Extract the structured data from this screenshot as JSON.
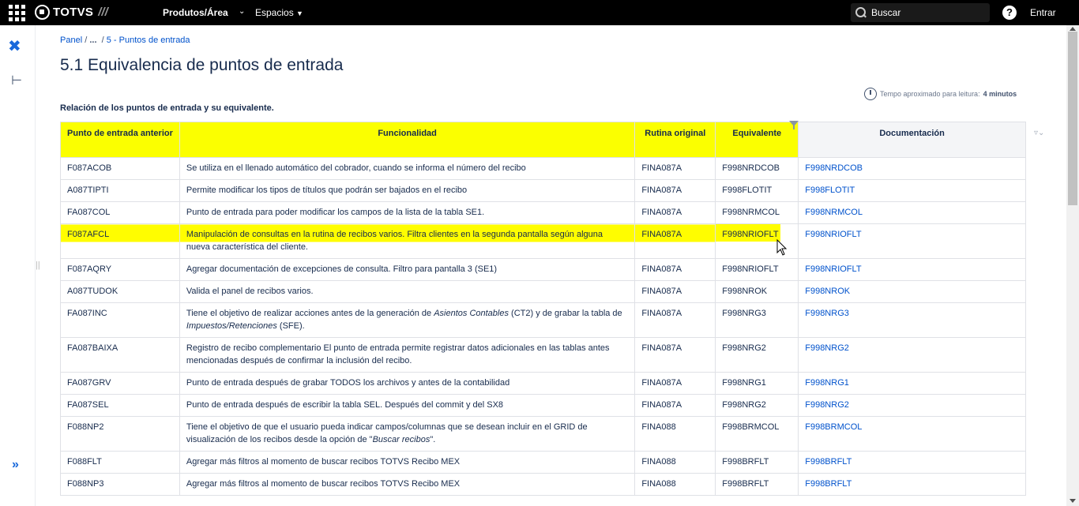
{
  "topbar": {
    "brand": "TOTVS",
    "brand_suffix": "///",
    "nav_productos": "Produtos/Área",
    "nav_espacios": "Espacios",
    "search_placeholder": "Buscar",
    "help": "?",
    "login": "Entrar"
  },
  "breadcrumb": {
    "panel": "Panel",
    "sep1": "/",
    "ellipsis": "...",
    "sep2": "/",
    "current": "5 - Puntos de entrada"
  },
  "page": {
    "title": "5.1 Equivalencia de puntos de entrada",
    "reading_prefix": "Tempo aproximado para leitura:",
    "reading_value": "4 minutos",
    "caption": "Relación de los puntos de entrada y su equivalente."
  },
  "table": {
    "headers": [
      "Punto de entrada anterior",
      "Funcionalidad",
      "Rutina original",
      "Equivalente",
      "Documentación"
    ],
    "rows": [
      {
        "pe": "F087ACOB",
        "func": "Se utiliza en el llenado automático del cobrador, cuando se informa el número del recibo",
        "rutina": "FINA087A",
        "equiv": "F998NRDCOB",
        "doc": "F998NRDCOB"
      },
      {
        "pe": "A087TIPTI",
        "func": "Permite modificar los tipos de títulos que podrán ser bajados en el recibo",
        "rutina": "FINA087A",
        "equiv": "F998FLOTIT",
        "doc": "F998FLOTIT"
      },
      {
        "pe": "FA087COL",
        "func": "Punto de entrada para poder modificar los campos de la lista de la tabla SE1.",
        "rutina": "FINA087A",
        "equiv": "F998NRMCOL",
        "doc": "F998NRMCOL"
      },
      {
        "pe": "F087AFCL",
        "func": "Manipulación de consultas en la rutina de recibos varios. Filtra clientes  en la segunda pantalla según alguna nueva característica del cliente.",
        "rutina": "FINA087A",
        "equiv": "F998NRIOFLT",
        "doc": "F998NRIOFLT"
      },
      {
        "pe": "F087AQRY",
        "func": "Agregar documentación de excepciones de consulta. Filtro para pantalla 3 (SE1)",
        "rutina": "FINA087A",
        "equiv": "F998NRIOFLT",
        "doc": "F998NRIOFLT"
      },
      {
        "pe": "A087TUDOK",
        "func": "Valida el panel de recibos varios.",
        "rutina": "FINA087A",
        "equiv": "F998NROK",
        "doc": "F998NROK"
      },
      {
        "pe": "FA087INC",
        "func_a": "Tiene el objetivo de realizar acciones antes de la generación de ",
        "func_b": "Asientos Contables",
        "func_c": " (CT2) y de grabar la tabla de ",
        "func_d": "Impuestos/Retenciones",
        "func_e": " (SFE).",
        "rutina": "FINA087A",
        "equiv": "F998NRG3",
        "doc": "F998NRG3"
      },
      {
        "pe": "FA087BAIXA",
        "func": "Registro de recibo complementario   El punto de entrada permite registrar datos adicionales en las tablas antes mencionadas después de confirmar la inclusión del recibo.",
        "rutina": "FINA087A",
        "equiv": "F998NRG2",
        "doc": "F998NRG2"
      },
      {
        "pe": "FA087GRV",
        "func": "Punto de entrada después de grabar TODOS los archivos y antes de la contabilidad",
        "rutina": "FINA087A",
        "equiv": "F998NRG1",
        "doc": "F998NRG1"
      },
      {
        "pe": "FA087SEL",
        "func": "Punto de entrada después de escribir la tabla SEL. Después del commit y del SX8",
        "rutina": "FINA087A",
        "equiv": "F998NRG2",
        "doc": "F998NRG2"
      },
      {
        "pe": "F088NP2",
        "func_a": "Tiene el objetivo de que el usuario pueda indicar campos/columnas que se desean incluir en el GRID de visualización de los recibos desde la opción de \"",
        "func_b": "Buscar recibos",
        "func_c": "\".",
        "rutina": "FINA088",
        "equiv": "F998BRMCOL",
        "doc": "F998BRMCOL"
      },
      {
        "pe": "F088FLT",
        "func": "Agregar más filtros al momento de buscar recibos TOTVS Recibo MEX",
        "rutina": "FINA088",
        "equiv": "F998BRFLT",
        "doc": "F998BRFLT"
      },
      {
        "pe": "F088NP3",
        "func": "Agregar más filtros al momento de buscar recibos TOTVS Recibo MEX",
        "rutina": "FINA088",
        "equiv": "F998BRFLT",
        "doc": "F998BRFLT"
      }
    ]
  },
  "icons": [
    "app-switcher-icon",
    "totvs-logo-icon",
    "chevron-down-icon",
    "search-icon",
    "help-icon",
    "confluence-icon",
    "page-tree-icon",
    "expand-sidebar-icon",
    "clock-icon",
    "filter-icon",
    "mouse-cursor-icon"
  ],
  "colors": {
    "highlight": "#fffd00",
    "link": "#0052cc",
    "topbar": "#000000"
  }
}
